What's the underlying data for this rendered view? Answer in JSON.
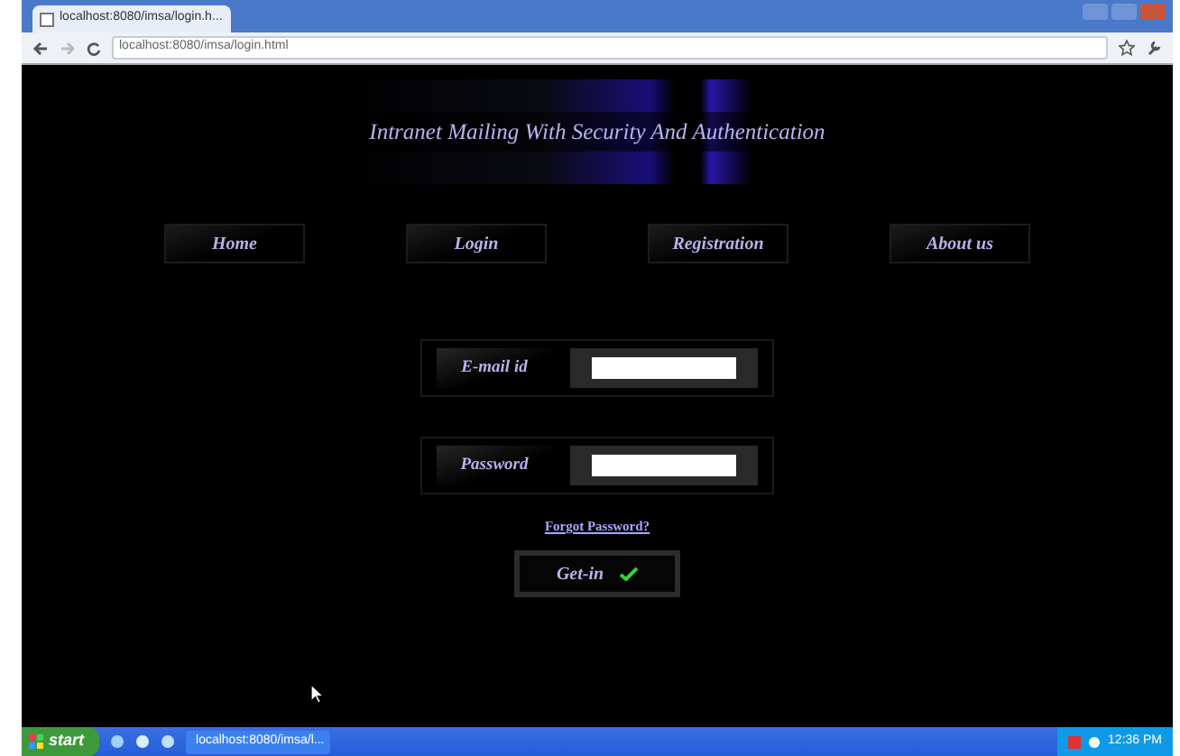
{
  "browser": {
    "tab_title": "localhost:8080/imsa/login.h...",
    "address": "localhost:8080/imsa/login.html"
  },
  "banner": {
    "title": "Intranet Mailing With Security And Authentication"
  },
  "nav": [
    {
      "label": "Home"
    },
    {
      "label": "Login"
    },
    {
      "label": "Registration"
    },
    {
      "label": "About us"
    }
  ],
  "form": {
    "fields": [
      {
        "label": "E-mail id"
      },
      {
        "label": "Password"
      }
    ],
    "forgot_link": "Forgot Password?",
    "submit": "Get-in"
  },
  "taskbar": {
    "start": "start",
    "task": "localhost:8080/imsa/l...",
    "clock": "12:36 PM"
  }
}
